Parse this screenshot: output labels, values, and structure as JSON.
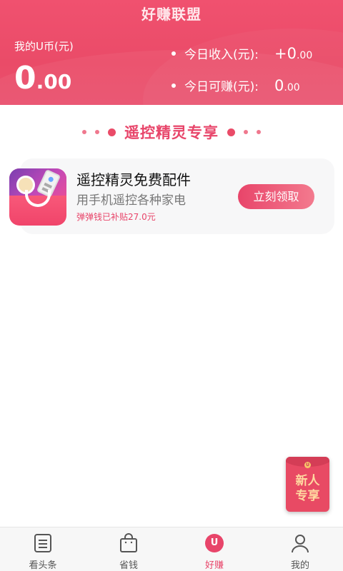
{
  "header": {
    "app_title": "好赚联盟",
    "balance_label": "我的U币(元)",
    "balance_int": "0",
    "balance_dec": ".00",
    "stats": [
      {
        "label": "今日收入(元):",
        "int": "+0",
        "dec": ".00"
      },
      {
        "label": "今日可赚(元):",
        "int": "0",
        "dec": ".00"
      }
    ]
  },
  "section": {
    "title": "遥控精灵专享"
  },
  "card": {
    "title": "遥控精灵免费配件",
    "subtitle": "用手机遥控各种家电",
    "note": "弹弹钱已补贴27.0元",
    "button": "立刻领取"
  },
  "newbie": {
    "line1": "新人",
    "line2": "专享",
    "seal": "U"
  },
  "nav": {
    "items": [
      {
        "label": "看头条",
        "icon": "news-list-icon"
      },
      {
        "label": "省钱",
        "icon": "shopping-bag-icon"
      },
      {
        "label": "好赚",
        "icon": "u-coin-icon",
        "active_glyph": "U"
      },
      {
        "label": "我的",
        "icon": "user-icon"
      }
    ]
  },
  "colors": {
    "accent": "#e8456a",
    "header_bg": "#ea4b68"
  }
}
